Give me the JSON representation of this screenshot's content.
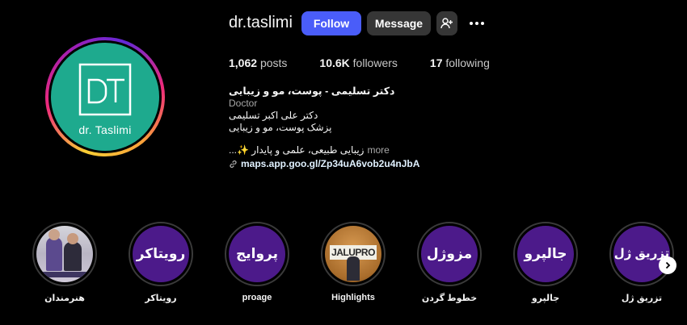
{
  "profile": {
    "username": "dr.taslimi",
    "avatar_text": "dr. Taslimi",
    "avatar_logo_letters": "DT",
    "colors": {
      "avatar_bg": "#1eaa8e",
      "follow_btn": "#4a5df9",
      "secondary_btn": "#363636",
      "highlight_bg": "#4c1a8a"
    }
  },
  "actions": {
    "follow_label": "Follow",
    "message_label": "Message",
    "add_user_icon": "person-add-icon",
    "more_icon": "more-horizontal-icon"
  },
  "stats": {
    "posts_count": "1,062",
    "posts_label": "posts",
    "followers_count": "10.6K",
    "followers_label": "followers",
    "following_count": "17",
    "following_label": "following"
  },
  "bio": {
    "title": "دکتر تسلیمی - پوست، مو و زیبایی",
    "category": "Doctor",
    "line1": "دکتر علی اکبر تسلیمی",
    "line2": "پزشک پوست، مو و زیبایی",
    "tagline": "زیبایی طبیعی، علمی و پایدار ✨...",
    "more_label": "more",
    "link_icon": "link-icon",
    "link": "maps.app.goo.gl/Zp34uA6vob2u4nJbA"
  },
  "highlights": [
    {
      "label": "هنرمندان",
      "cover_text": ""
    },
    {
      "label": "رویتاکر",
      "cover_text": "رویتاکر"
    },
    {
      "label": "proage",
      "cover_text": "پروایج"
    },
    {
      "label": "Highlights",
      "cover_text": "JALUPRO"
    },
    {
      "label": "خطوط گردن",
      "cover_text": "مزوژل"
    },
    {
      "label": "جالپرو",
      "cover_text": "جالپرو"
    },
    {
      "label": "تزریق ژل",
      "cover_text": "تزریق ژل"
    }
  ],
  "next_icon": "chevron-right-icon"
}
